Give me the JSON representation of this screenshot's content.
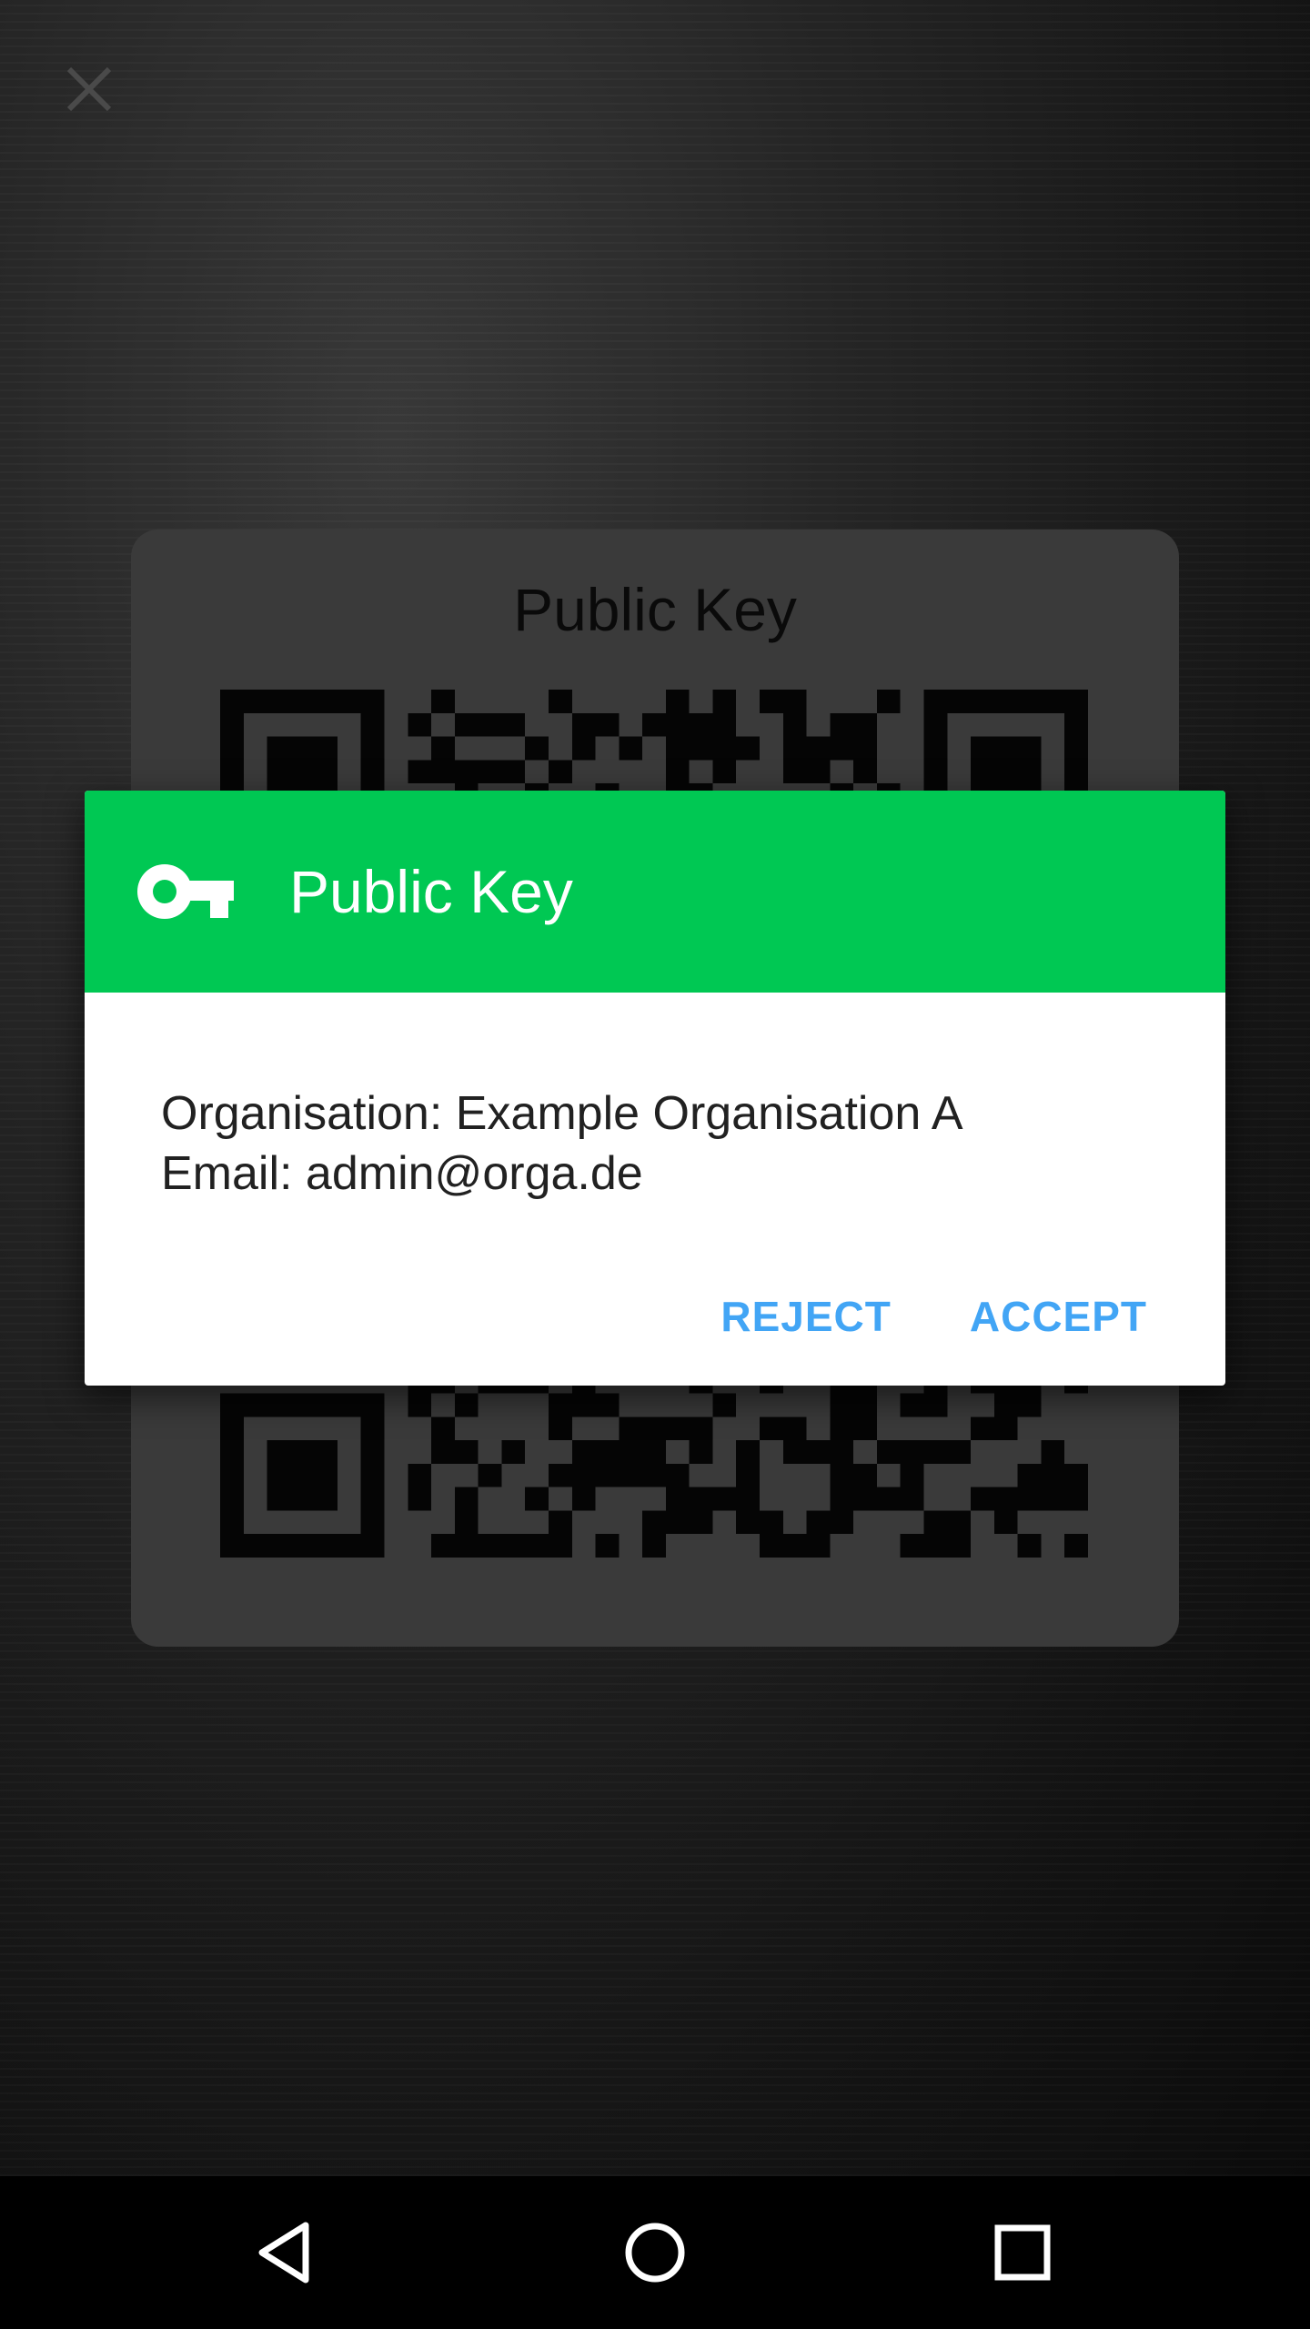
{
  "app": {
    "close_icon": "close-icon"
  },
  "qr_card": {
    "title": "Public Key"
  },
  "dialog": {
    "icon": "key-icon",
    "title": "Public Key",
    "header_color": "#00c853",
    "organisation_line": "Organisation: Example Organisation A",
    "email_line": "Email: admin@orga.de",
    "reject_label": "REJECT",
    "accept_label": "ACCEPT",
    "button_color": "#42a5f5"
  },
  "nav_bar": {
    "back_icon": "back-triangle-icon",
    "home_icon": "home-circle-icon",
    "recent_icon": "recent-apps-square-icon"
  }
}
